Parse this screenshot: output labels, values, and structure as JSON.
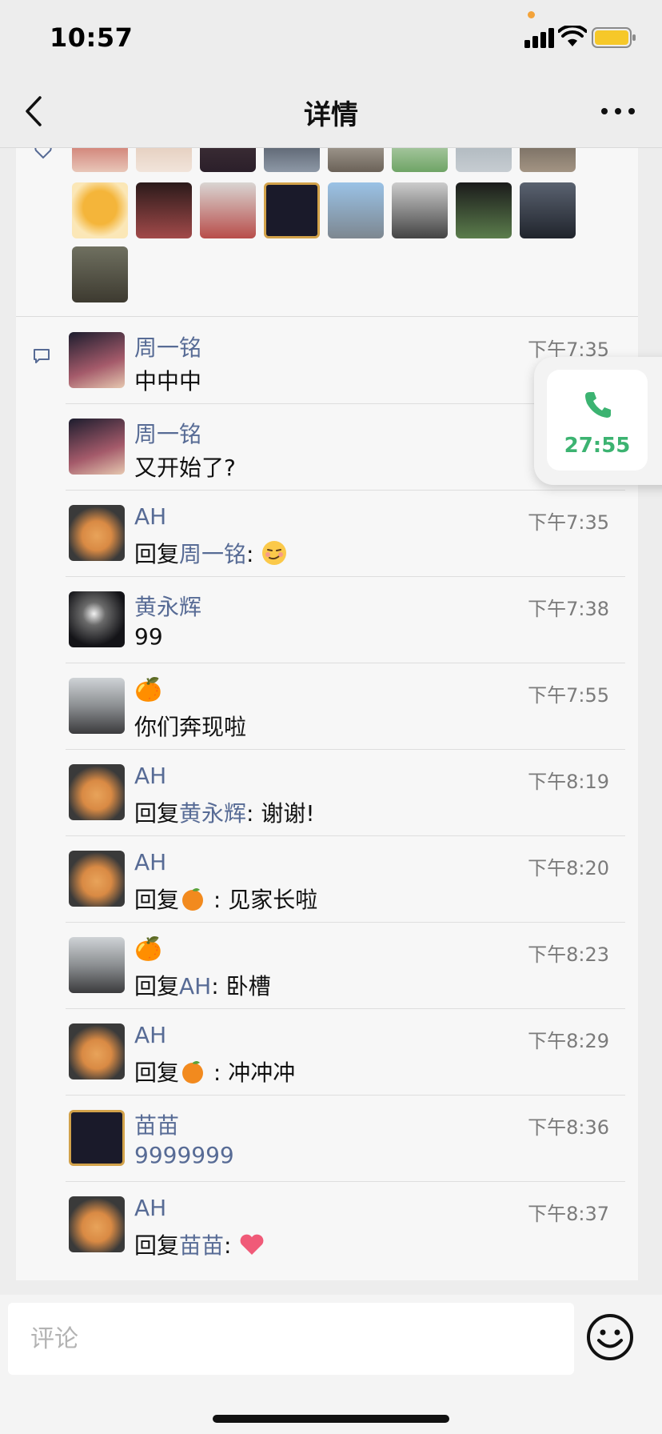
{
  "status_bar": {
    "time": "10:57"
  },
  "nav": {
    "title": "详情"
  },
  "call": {
    "duration": "27:55"
  },
  "comments": [
    {
      "name": "周一铭",
      "time": "下午7:35",
      "text": "中中中"
    },
    {
      "name": "周一铭",
      "time": "",
      "text": "又开始了?"
    },
    {
      "name": "AH",
      "time": "下午7:35",
      "prefix": "回复",
      "target": "周一铭",
      "sep": ": "
    },
    {
      "name": "黄永辉",
      "time": "下午7:38",
      "text": "99"
    },
    {
      "name": "🍊",
      "time": "下午7:55",
      "text": "你们奔现啦"
    },
    {
      "name": "AH",
      "time": "下午8:19",
      "prefix": "回复",
      "target": "黄永辉",
      "sep": ": ",
      "text": "谢谢!"
    },
    {
      "name": "AH",
      "time": "下午8:20",
      "prefix": "回复",
      "sep": " : ",
      "text": "见家长啦"
    },
    {
      "name": "🍊",
      "time": "下午8:23",
      "prefix": "回复",
      "target": "AH",
      "sep": ": ",
      "text": "卧槽"
    },
    {
      "name": "AH",
      "time": "下午8:29",
      "prefix": "回复",
      "sep": " : ",
      "text": "冲冲冲"
    },
    {
      "name": "苗苗",
      "time": "下午8:36",
      "text": "9999999"
    },
    {
      "name": "AH",
      "time": "下午8:37",
      "prefix": "回复",
      "target": "苗苗",
      "sep": ": "
    }
  ],
  "input": {
    "placeholder": "评论"
  },
  "icons": {
    "back": "chevron-left-icon",
    "more": "more-dots-icon",
    "like": "heart-outline-icon",
    "comment": "comment-bubble-icon",
    "call": "phone-icon",
    "emoji": "smiley-icon"
  },
  "colors": {
    "link": "#576b95",
    "call_green": "#3cb371",
    "background": "#ededed"
  }
}
